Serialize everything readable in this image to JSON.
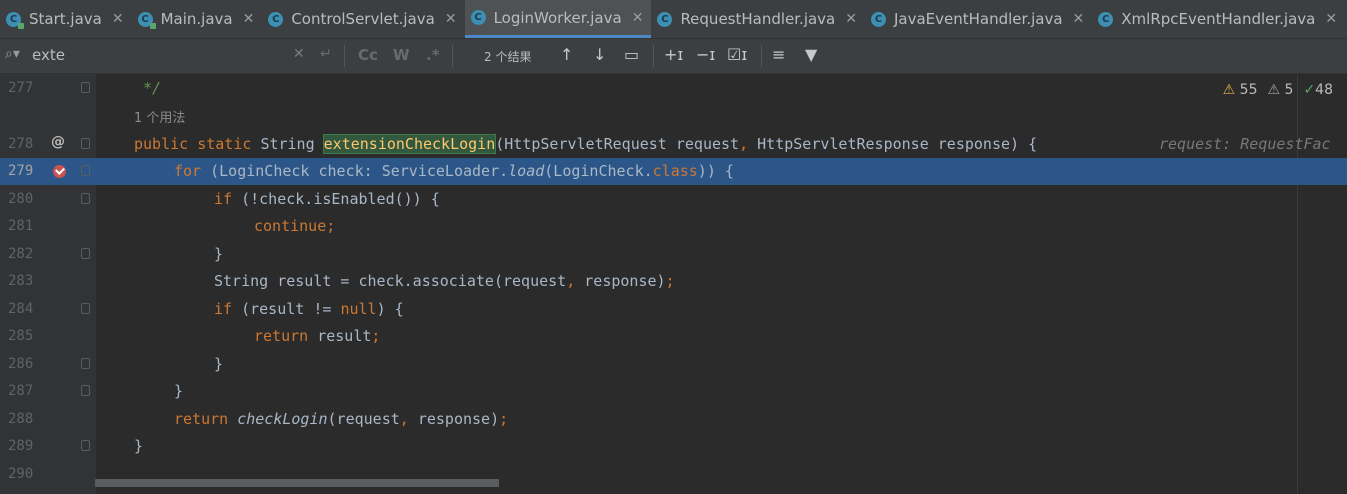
{
  "tabs": [
    {
      "label": "Start.java",
      "icon": "java-class-run-icon",
      "active": false
    },
    {
      "label": "Main.java",
      "icon": "java-class-run-icon",
      "active": false
    },
    {
      "label": "ControlServlet.java",
      "icon": "java-class-icon",
      "active": false
    },
    {
      "label": "LoginWorker.java",
      "icon": "java-class-icon",
      "active": true
    },
    {
      "label": "RequestHandler.java",
      "icon": "java-class-icon",
      "active": false
    },
    {
      "label": "JavaEventHandler.java",
      "icon": "java-class-icon",
      "active": false
    },
    {
      "label": "XmlRpcEventHandler.java",
      "icon": "java-class-icon",
      "active": false
    }
  ],
  "find": {
    "query": "exte",
    "results": "2 个结果",
    "opt_case": "Cc",
    "opt_word": "W",
    "opt_regex": ".*"
  },
  "inspection": {
    "warnings": "55",
    "weak_warnings": "5",
    "ok": "48"
  },
  "usage_hint": "1 个用法",
  "param_hint": "request: RequestFac",
  "lines": {
    "l277": {
      "num": "277",
      "text": " */"
    },
    "l278": {
      "num": "278",
      "text": "public static String extensionCheckLogin(HttpServletRequest request, HttpServletResponse response) {"
    },
    "l279": {
      "num": "279",
      "text": "for (LoginCheck check: ServiceLoader.load(LoginCheck.class)) {"
    },
    "l280": {
      "num": "280",
      "text": "if (!check.isEnabled()) {"
    },
    "l281": {
      "num": "281",
      "text": "continue;"
    },
    "l282": {
      "num": "282",
      "text": "}"
    },
    "l283": {
      "num": "283",
      "text": "String result = check.associate(request, response);"
    },
    "l284": {
      "num": "284",
      "text": "if (result != null) {"
    },
    "l285": {
      "num": "285",
      "text": "return result;"
    },
    "l286": {
      "num": "286",
      "text": "}"
    },
    "l287": {
      "num": "287",
      "text": "}"
    },
    "l288": {
      "num": "288",
      "text": "return checkLogin(request, response);"
    },
    "l289": {
      "num": "289",
      "text": "}"
    },
    "l290": {
      "num": "290",
      "text": ""
    }
  },
  "colors": {
    "accent": "#4a88c7",
    "selection": "#2d5688",
    "keyword": "#cc7832",
    "method": "#ffc66d",
    "breakpoint": "#c75450"
  }
}
